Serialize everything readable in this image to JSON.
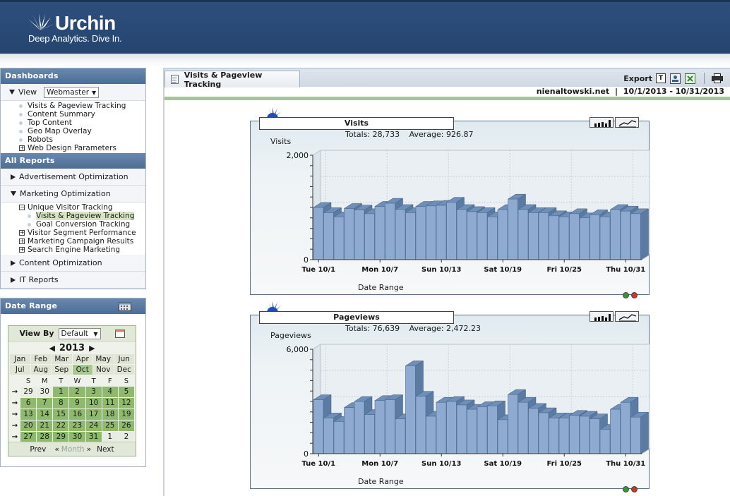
{
  "brand": {
    "name": "Urchin",
    "tagline": "Deep Analytics. Dive In."
  },
  "dashboards": {
    "title": "Dashboards",
    "view_label": "View",
    "view_value": "Webmaster",
    "items": [
      {
        "label": "Visits & Pageview Tracking",
        "type": "bullet"
      },
      {
        "label": "Content Summary",
        "type": "bullet"
      },
      {
        "label": "Top Content",
        "type": "bullet"
      },
      {
        "label": "Geo Map Overlay",
        "type": "bullet"
      },
      {
        "label": "Robots",
        "type": "bullet"
      },
      {
        "label": "Web Design Parameters",
        "type": "plus"
      }
    ]
  },
  "all_reports": {
    "title": "All Reports",
    "sections": [
      {
        "label": "Advertisement Optimization"
      },
      {
        "label": "Marketing Optimization"
      },
      {
        "label": "Content Optimization"
      },
      {
        "label": "IT Reports"
      }
    ],
    "marketing_items": [
      {
        "label": "Unique Visitor Tracking",
        "type": "minus"
      },
      {
        "label": "Visits & Pageview Tracking",
        "type": "bullet",
        "indent": true,
        "active": true
      },
      {
        "label": "Goal Conversion Tracking",
        "type": "bullet",
        "indent": true
      },
      {
        "label": "Visitor Segment Performance",
        "type": "plus"
      },
      {
        "label": "Marketing Campaign Results",
        "type": "plus"
      },
      {
        "label": "Search Engine Marketing",
        "type": "plus"
      }
    ]
  },
  "date_range": {
    "title": "Date Range",
    "view_by_label": "View By",
    "view_by_value": "Default",
    "year": "2013",
    "months": [
      "Jan",
      "Feb",
      "Mar",
      "Apr",
      "May",
      "Jun",
      "Jul",
      "Aug",
      "Sep",
      "Oct",
      "Nov",
      "Dec"
    ],
    "selected_month": "Oct",
    "dow": [
      "S",
      "M",
      "T",
      "W",
      "T",
      "F",
      "S"
    ],
    "weeks": [
      [
        "29",
        "30",
        "1",
        "2",
        "3",
        "4",
        "5"
      ],
      [
        "6",
        "7",
        "8",
        "9",
        "10",
        "11",
        "12"
      ],
      [
        "13",
        "14",
        "15",
        "16",
        "17",
        "18",
        "19"
      ],
      [
        "20",
        "21",
        "22",
        "23",
        "24",
        "25",
        "26"
      ],
      [
        "27",
        "28",
        "29",
        "30",
        "31",
        "1",
        "2"
      ]
    ],
    "in_range": [
      [
        false,
        false,
        true,
        true,
        true,
        true,
        true
      ],
      [
        true,
        true,
        true,
        true,
        true,
        true,
        true
      ],
      [
        true,
        true,
        true,
        true,
        true,
        true,
        true
      ],
      [
        true,
        true,
        true,
        true,
        true,
        true,
        true
      ],
      [
        true,
        true,
        true,
        true,
        true,
        false,
        false
      ]
    ],
    "prev_label": "Prev",
    "month_label": "Month",
    "next_label": "Next"
  },
  "main": {
    "tab_label": "Visits & Pageview Tracking",
    "export_label": "Export",
    "profile": "nienaltowski.net",
    "separator": "|",
    "range": "10/1/2013 - 10/31/2013"
  },
  "colors": {
    "header_bg": "#2a4a76",
    "bar_front": "#8aaad0",
    "bar_top": "#5e7fa8",
    "range_green": "#8fb96d"
  },
  "chart_data": [
    {
      "type": "bar",
      "title": "Visits",
      "totals_text": "Totals: 28,733",
      "average_text": "Average: 926.87",
      "ylabel": "Visits",
      "xlabel": "Date Range",
      "ylim": [
        0,
        2000
      ],
      "yticks": [
        "2,000",
        "0"
      ],
      "tick_labels": [
        "Tue 10/1",
        "Mon 10/7",
        "Sun 10/13",
        "Sat 10/19",
        "Fri 10/25",
        "Thu 10/31"
      ],
      "tick_index": [
        0,
        6,
        12,
        18,
        24,
        30
      ],
      "values": [
        1000,
        900,
        820,
        980,
        950,
        880,
        1020,
        1080,
        960,
        900,
        1020,
        1030,
        1040,
        1100,
        960,
        920,
        900,
        820,
        960,
        1160,
        960,
        900,
        900,
        840,
        820,
        880,
        800,
        860,
        820,
        960,
        930,
        880
      ]
    },
    {
      "type": "bar",
      "title": "Pageviews",
      "totals_text": "Totals: 76,639",
      "average_text": "Average: 2,472.23",
      "ylabel": "Pageviews",
      "xlabel": "Date Range",
      "ylim": [
        0,
        6000
      ],
      "yticks": [
        "6,000",
        "0"
      ],
      "tick_labels": [
        "Tue 10/1",
        "Mon 10/7",
        "Sun 10/13",
        "Sat 10/19",
        "Fri 10/25",
        "Thu 10/31"
      ],
      "tick_index": [
        0,
        6,
        12,
        18,
        24,
        30
      ],
      "values": [
        3100,
        2050,
        1850,
        2650,
        3000,
        2250,
        3050,
        3100,
        2000,
        5050,
        3300,
        2150,
        2950,
        3000,
        2800,
        2550,
        2700,
        2750,
        1950,
        3400,
        2950,
        2600,
        2350,
        2050,
        2050,
        2200,
        2150,
        2000,
        1400,
        2550,
        2950,
        2100
      ]
    }
  ]
}
